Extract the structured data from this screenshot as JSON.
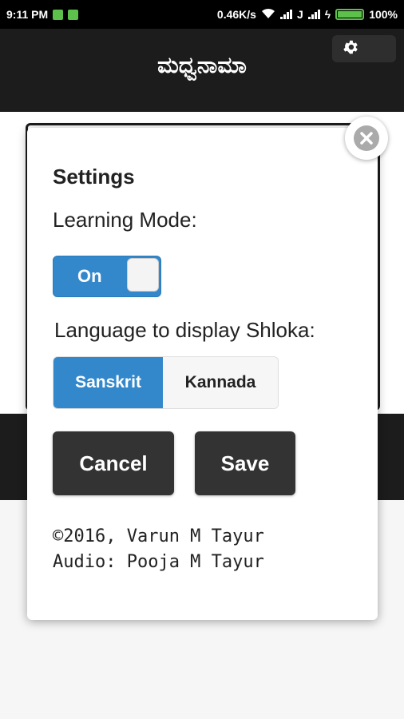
{
  "status_bar": {
    "time": "9:11 PM",
    "speed": "0.46K/s",
    "carrier": "J",
    "battery_percent": "100%"
  },
  "header": {
    "title": "ಮಧ್ವನಾಮಾ",
    "settings_icon": "gear-icon"
  },
  "settings_modal": {
    "title": "Settings",
    "learning_mode_label": "Learning Mode:",
    "learning_mode_toggle": "On",
    "language_label": "Language to display Shloka:",
    "language_options": [
      "Sanskrit",
      "Kannada"
    ],
    "language_selected": "Sanskrit",
    "cancel_label": "Cancel",
    "save_label": "Save",
    "footer_line1": "©2016, Varun M Tayur",
    "footer_line2": "Audio: Pooja M Tayur",
    "close_icon": "close-icon"
  },
  "colors": {
    "accent": "#3388cc",
    "header_bg": "#1c1c1c",
    "button_bg": "#333333"
  }
}
